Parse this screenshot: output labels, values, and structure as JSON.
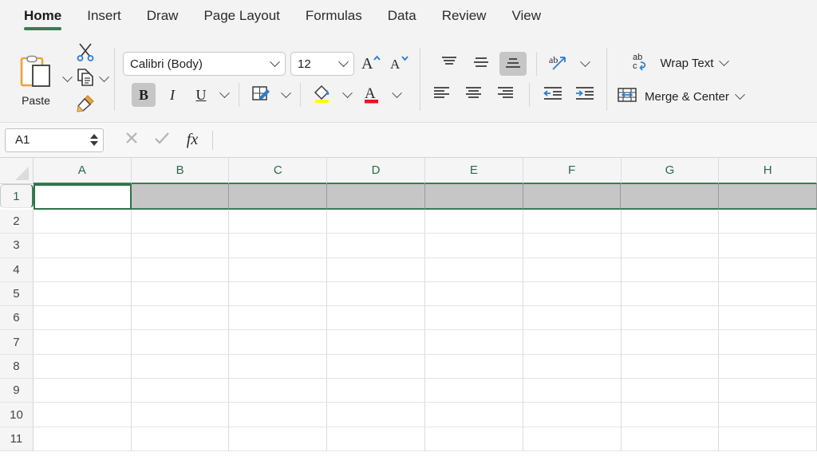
{
  "app": {
    "tabs": [
      {
        "label": "Home",
        "active": true
      },
      {
        "label": "Insert",
        "active": false
      },
      {
        "label": "Draw",
        "active": false
      },
      {
        "label": "Page Layout",
        "active": false
      },
      {
        "label": "Formulas",
        "active": false
      },
      {
        "label": "Data",
        "active": false
      },
      {
        "label": "Review",
        "active": false
      },
      {
        "label": "View",
        "active": false
      }
    ],
    "accent_green": "#3b7a55",
    "header_text_green": "#2b6a45",
    "selection_gray": "#c6c6c6",
    "ribbon_bg": "#f3f3f3"
  },
  "ribbon": {
    "clipboard": {
      "paste_label": "Paste",
      "paste_icon": "clipboard-icon",
      "paste_dropdown_icon": "chevron-down-icon",
      "cut_icon": "scissors-icon",
      "copy_icon": "copy-icon",
      "copy_dropdown_icon": "chevron-down-icon",
      "format_painter_icon": "format-painter-icon"
    },
    "font": {
      "font_name": "Calibri (Body)",
      "font_name_dropdown_icon": "chevron-down-icon",
      "font_size": "12",
      "font_size_dropdown_icon": "chevron-down-icon",
      "grow_font_label": "A",
      "grow_font_icon": "increase-font-icon",
      "shrink_font_label": "A",
      "shrink_font_icon": "decrease-font-icon",
      "bold_label": "B",
      "bold_active": true,
      "italic_label": "I",
      "underline_label": "U",
      "underline_dropdown_icon": "chevron-down-icon",
      "borders_icon": "borders-icon",
      "borders_dropdown_icon": "chevron-down-icon",
      "fill_color_icon": "fill-color-icon",
      "fill_color_swatch": "#ffff00",
      "fill_dropdown_icon": "chevron-down-icon",
      "font_color_label": "A",
      "font_color_icon": "font-color-icon",
      "font_color_swatch": "#e81123",
      "font_color_dropdown_icon": "chevron-down-icon"
    },
    "alignment": {
      "align_top_icon": "align-top-icon",
      "align_middle_icon": "align-middle-icon",
      "align_bottom_icon": "align-bottom-icon",
      "align_bottom_active": true,
      "orientation_icon": "text-orientation-icon",
      "orientation_label": "ab",
      "orientation_dropdown_icon": "chevron-down-icon",
      "align_left_icon": "align-left-icon",
      "align_center_icon": "align-center-icon",
      "align_right_icon": "align-right-icon",
      "decrease_indent_icon": "decrease-indent-icon",
      "increase_indent_icon": "increase-indent-icon",
      "wrap_text_label": "Wrap Text",
      "wrap_text_icon": "wrap-text-icon",
      "wrap_text_dropdown_icon": "chevron-down-icon",
      "merge_center_label": "Merge & Center",
      "merge_center_icon": "merge-cells-icon",
      "merge_center_dropdown_icon": "chevron-down-icon"
    }
  },
  "formula_bar": {
    "name_box_value": "A1",
    "name_box_spinner_up_icon": "triangle-up-icon",
    "name_box_spinner_down_icon": "triangle-down-icon",
    "cancel_icon": "close-icon",
    "enter_icon": "check-icon",
    "function_icon": "fx-icon",
    "function_label": "fx",
    "formula_value": ""
  },
  "grid": {
    "select_all_icon": "select-all-corner-icon",
    "columns": [
      "A",
      "B",
      "C",
      "D",
      "E",
      "F",
      "G",
      "H"
    ],
    "rows": [
      "1",
      "2",
      "3",
      "4",
      "5",
      "6",
      "7",
      "8",
      "9",
      "10",
      "11"
    ],
    "active_cell": "A1",
    "selected_row": "1",
    "cell_values": []
  }
}
